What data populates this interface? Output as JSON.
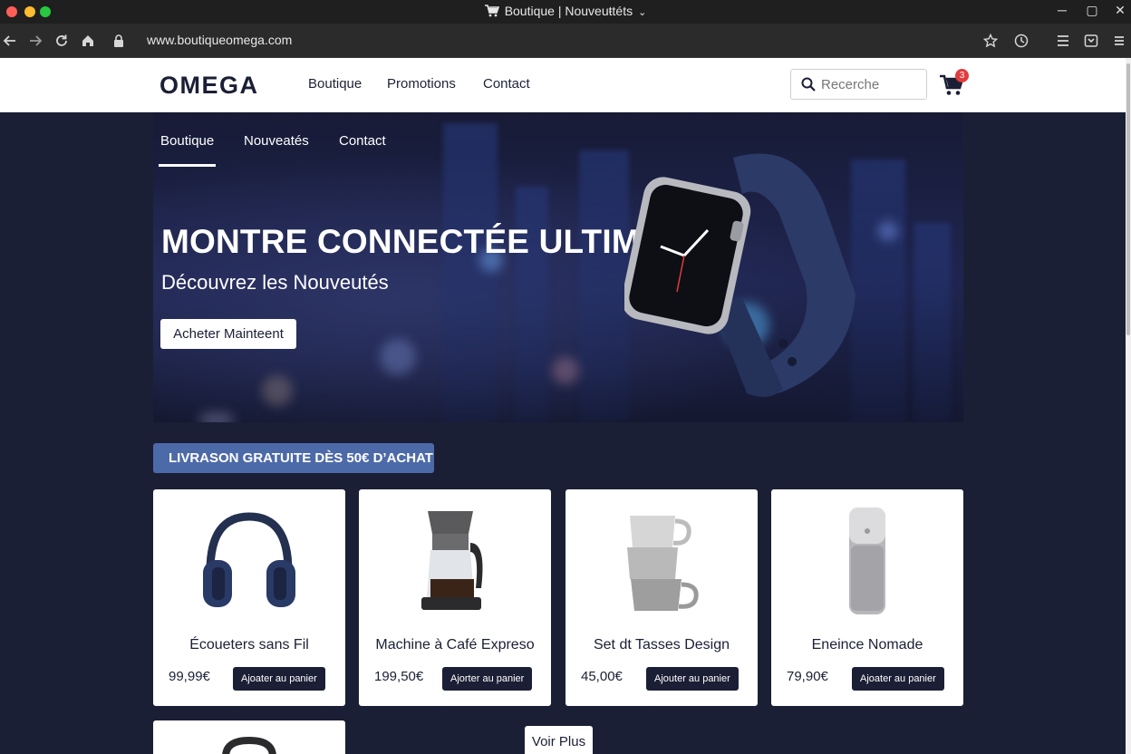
{
  "window": {
    "title": "Boutique | Nouveuŧtéts",
    "url": "www.boutiqueomega.com"
  },
  "header": {
    "logo": "OMEGA",
    "nav": [
      "Boutique",
      "Promotions",
      "Contact"
    ],
    "search_placeholder": "Recerche",
    "cart_count": "3"
  },
  "hero": {
    "tabs": [
      "Boutique",
      "Nouveatés",
      "Contact"
    ],
    "active_tab": "Boutique",
    "title": "MONTRE CONNECTÉE ULTIME",
    "subtitle": "Découvrez les Nouveutés",
    "cta": "Acheter Mainteent"
  },
  "banner": {
    "text": "LIVRASON GRATUITE DÈS 50€ D’ACHAT"
  },
  "products": [
    {
      "name": "Écoueters sans Fil",
      "price": "99,99€",
      "button": "Ajoater au panier",
      "icon": "headphones-icon"
    },
    {
      "name": "Machine à Café Expreso",
      "price": "199,50€",
      "button": "Ajorter au panier",
      "icon": "coffee-machine-icon"
    },
    {
      "name": "Set dt Tasses Design",
      "price": "45,00€",
      "button": "Ajouter au panier",
      "icon": "cups-icon"
    },
    {
      "name": "Eneince Nomade",
      "price": "79,90€",
      "button": "Ajoater au panier",
      "icon": "speaker-icon"
    }
  ],
  "more_button": "Voir Plus",
  "colors": {
    "background": "#1b1f35",
    "banner": "#4d6aa8",
    "button_dark": "#1b1f35",
    "badge": "#e23b3b"
  }
}
